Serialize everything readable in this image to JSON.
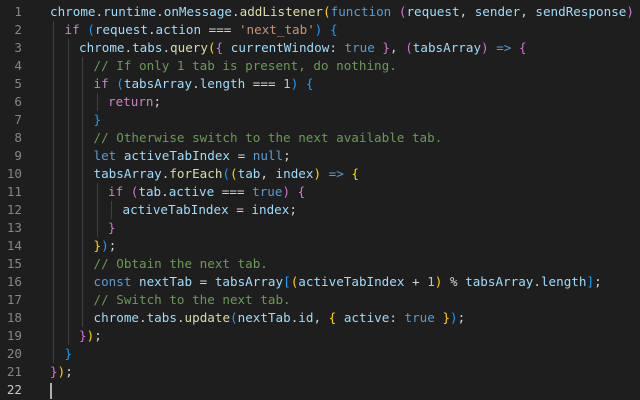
{
  "editor": {
    "cursor_line": 22,
    "lines": [
      {
        "n": "1",
        "indent": 0,
        "tokens": [
          [
            "chrome",
            "var"
          ],
          [
            ".",
            ""
          ],
          [
            "runtime",
            "var"
          ],
          [
            ".",
            ""
          ],
          [
            "onMessage",
            "var"
          ],
          [
            ".",
            ""
          ],
          [
            "addListener",
            "fn"
          ],
          [
            "(",
            "b1"
          ],
          [
            "function",
            "store"
          ],
          [
            " ",
            ""
          ],
          [
            "(",
            "b2"
          ],
          [
            "request",
            "var"
          ],
          [
            ", ",
            ""
          ],
          [
            "sender",
            "var"
          ],
          [
            ", ",
            ""
          ],
          [
            "sendResponse",
            "var"
          ],
          [
            ")",
            "b2"
          ],
          [
            " ",
            ""
          ],
          [
            "{",
            "b2"
          ]
        ]
      },
      {
        "n": "2",
        "indent": 1,
        "tokens": [
          [
            "if",
            "kw"
          ],
          [
            " ",
            ""
          ],
          [
            "(",
            "b3"
          ],
          [
            "request",
            "var"
          ],
          [
            ".",
            ""
          ],
          [
            "action",
            "var"
          ],
          [
            " === ",
            ""
          ],
          [
            "'next_tab'",
            "str"
          ],
          [
            ")",
            "b3"
          ],
          [
            " ",
            ""
          ],
          [
            "{",
            "b3"
          ]
        ]
      },
      {
        "n": "3",
        "indent": 2,
        "tokens": [
          [
            "chrome",
            "var"
          ],
          [
            ".",
            ""
          ],
          [
            "tabs",
            "var"
          ],
          [
            ".",
            ""
          ],
          [
            "query",
            "fn"
          ],
          [
            "(",
            "b1"
          ],
          [
            "{",
            "b2"
          ],
          [
            " ",
            ""
          ],
          [
            "currentWindow",
            "var"
          ],
          [
            ": ",
            ""
          ],
          [
            "true",
            "store"
          ],
          [
            " ",
            ""
          ],
          [
            "}",
            "b2"
          ],
          [
            ", ",
            ""
          ],
          [
            "(",
            "b2"
          ],
          [
            "tabsArray",
            "var"
          ],
          [
            ")",
            "b2"
          ],
          [
            " ",
            ""
          ],
          [
            "=>",
            "store"
          ],
          [
            " ",
            ""
          ],
          [
            "{",
            "b2"
          ]
        ]
      },
      {
        "n": "4",
        "indent": 3,
        "tokens": [
          [
            "// If only 1 tab is present, do nothing.",
            "cmt"
          ]
        ]
      },
      {
        "n": "5",
        "indent": 3,
        "tokens": [
          [
            "if",
            "kw"
          ],
          [
            " ",
            ""
          ],
          [
            "(",
            "b3"
          ],
          [
            "tabsArray",
            "var"
          ],
          [
            ".",
            ""
          ],
          [
            "length",
            "var"
          ],
          [
            " === ",
            ""
          ],
          [
            "1",
            "num"
          ],
          [
            ")",
            "b3"
          ],
          [
            " ",
            ""
          ],
          [
            "{",
            "b3"
          ]
        ]
      },
      {
        "n": "6",
        "indent": 4,
        "tokens": [
          [
            "return",
            "kw"
          ],
          [
            ";",
            ""
          ]
        ]
      },
      {
        "n": "7",
        "indent": 3,
        "tokens": [
          [
            "}",
            "b3"
          ]
        ]
      },
      {
        "n": "8",
        "indent": 3,
        "tokens": [
          [
            "// Otherwise switch to the next available tab.",
            "cmt"
          ]
        ]
      },
      {
        "n": "9",
        "indent": 3,
        "tokens": [
          [
            "let",
            "store"
          ],
          [
            " ",
            ""
          ],
          [
            "activeTabIndex",
            "var"
          ],
          [
            " = ",
            ""
          ],
          [
            "null",
            "store"
          ],
          [
            ";",
            ""
          ]
        ]
      },
      {
        "n": "10",
        "indent": 3,
        "tokens": [
          [
            "tabsArray",
            "var"
          ],
          [
            ".",
            ""
          ],
          [
            "forEach",
            "fn"
          ],
          [
            "(",
            "b3"
          ],
          [
            "(",
            "b1"
          ],
          [
            "tab",
            "var"
          ],
          [
            ", ",
            ""
          ],
          [
            "index",
            "var"
          ],
          [
            ")",
            "b1"
          ],
          [
            " ",
            ""
          ],
          [
            "=>",
            "store"
          ],
          [
            " ",
            ""
          ],
          [
            "{",
            "b1"
          ]
        ]
      },
      {
        "n": "11",
        "indent": 4,
        "tokens": [
          [
            "if",
            "kw"
          ],
          [
            " ",
            ""
          ],
          [
            "(",
            "b2"
          ],
          [
            "tab",
            "var"
          ],
          [
            ".",
            ""
          ],
          [
            "active",
            "var"
          ],
          [
            " === ",
            ""
          ],
          [
            "true",
            "store"
          ],
          [
            ")",
            "b2"
          ],
          [
            " ",
            ""
          ],
          [
            "{",
            "b2"
          ]
        ]
      },
      {
        "n": "12",
        "indent": 5,
        "tokens": [
          [
            "activeTabIndex",
            "var"
          ],
          [
            " = ",
            ""
          ],
          [
            "index",
            "var"
          ],
          [
            ";",
            ""
          ]
        ]
      },
      {
        "n": "13",
        "indent": 4,
        "tokens": [
          [
            "}",
            "b2"
          ]
        ]
      },
      {
        "n": "14",
        "indent": 3,
        "tokens": [
          [
            "}",
            "b1"
          ],
          [
            ")",
            "b3"
          ],
          [
            ";",
            ""
          ]
        ]
      },
      {
        "n": "15",
        "indent": 3,
        "tokens": [
          [
            "// Obtain the next tab.",
            "cmt"
          ]
        ]
      },
      {
        "n": "16",
        "indent": 3,
        "tokens": [
          [
            "const",
            "store"
          ],
          [
            " ",
            ""
          ],
          [
            "nextTab",
            "var"
          ],
          [
            " = ",
            ""
          ],
          [
            "tabsArray",
            "var"
          ],
          [
            "[",
            "b3"
          ],
          [
            "(",
            "b1"
          ],
          [
            "activeTabIndex",
            "var"
          ],
          [
            " + ",
            ""
          ],
          [
            "1",
            "num"
          ],
          [
            ")",
            "b1"
          ],
          [
            " % ",
            ""
          ],
          [
            "tabsArray",
            "var"
          ],
          [
            ".",
            ""
          ],
          [
            "length",
            "var"
          ],
          [
            "]",
            "b3"
          ],
          [
            ";",
            ""
          ]
        ]
      },
      {
        "n": "17",
        "indent": 3,
        "tokens": [
          [
            "// Switch to the next tab.",
            "cmt"
          ]
        ]
      },
      {
        "n": "18",
        "indent": 3,
        "tokens": [
          [
            "chrome",
            "var"
          ],
          [
            ".",
            ""
          ],
          [
            "tabs",
            "var"
          ],
          [
            ".",
            ""
          ],
          [
            "update",
            "fn"
          ],
          [
            "(",
            "b3"
          ],
          [
            "nextTab",
            "var"
          ],
          [
            ".",
            ""
          ],
          [
            "id",
            "var"
          ],
          [
            ", ",
            ""
          ],
          [
            "{",
            "b1"
          ],
          [
            " ",
            ""
          ],
          [
            "active",
            "var"
          ],
          [
            ": ",
            ""
          ],
          [
            "true",
            "store"
          ],
          [
            " ",
            ""
          ],
          [
            "}",
            "b1"
          ],
          [
            ")",
            "b3"
          ],
          [
            ";",
            ""
          ]
        ]
      },
      {
        "n": "19",
        "indent": 2,
        "tokens": [
          [
            "}",
            "b2"
          ],
          [
            ")",
            "b1"
          ],
          [
            ";",
            ""
          ]
        ]
      },
      {
        "n": "20",
        "indent": 1,
        "tokens": [
          [
            "}",
            "b3"
          ]
        ]
      },
      {
        "n": "21",
        "indent": 0,
        "tokens": [
          [
            "}",
            "b2"
          ],
          [
            ")",
            "b1"
          ],
          [
            ";",
            ""
          ]
        ]
      },
      {
        "n": "22",
        "indent": 0,
        "tokens": []
      }
    ]
  }
}
